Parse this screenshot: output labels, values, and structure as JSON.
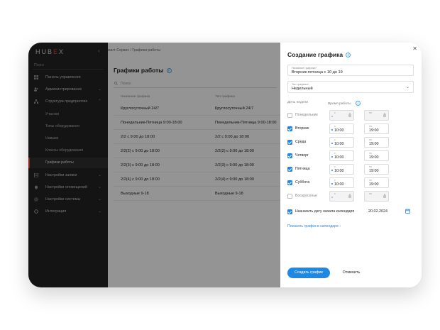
{
  "app": {
    "logo_prefix": "HUB",
    "logo_x": "E",
    "logo_suffix": "X"
  },
  "sidebar": {
    "search_placeholder": "Поиск",
    "items": [
      {
        "label": "Панель управления",
        "icon": "dashboard-icon"
      },
      {
        "label": "Администрирование",
        "icon": "users-icon"
      },
      {
        "label": "Структура предприятия",
        "icon": "structure-icon"
      },
      {
        "label": "Настройки заявки",
        "icon": "requests-icon"
      },
      {
        "label": "Настройки оповещений",
        "icon": "bell-icon"
      },
      {
        "label": "Настройки системы",
        "icon": "settings-icon"
      },
      {
        "label": "Интеграция",
        "icon": "integration-icon"
      }
    ],
    "subitems": [
      "Участки",
      "Типы оборудования",
      "Навыки",
      "Классы оборудования",
      "Графики работы"
    ]
  },
  "main": {
    "breadcrumb": "мarт-Сервис / Графики работы",
    "title": "Графики работы",
    "search_placeholder": "Поиск",
    "columns": [
      "Название графика",
      "Тип графика"
    ],
    "rows": [
      {
        "name": "Круглосуточный 24/7",
        "type": "Круглосуточный 24/7"
      },
      {
        "name": "Понедельник-Пятница 9:00-18:00",
        "type": "Понедельник-Пятница 9:00-18:00"
      },
      {
        "name": "2/2 с 9:00 до 18:00",
        "type": "2/2 с 9:00 до 18:00"
      },
      {
        "name": "2/2(2) с 9:00 до 18:00",
        "type": "2/2(2) с 9:00 до 18:00"
      },
      {
        "name": "2/2(3) с 9:00 до 18:00",
        "type": "2/2(3) с 9:00 до 18:00"
      },
      {
        "name": "2/2(4) с 9:00 до 18:00",
        "type": "2/2(4) с 9:00 до 18:00"
      },
      {
        "name": "Выходные 9-18",
        "type": "Выходные 9-18"
      }
    ]
  },
  "panel": {
    "title": "Создание графика",
    "name_label": "Название графика*",
    "name_value": "Вторник-пятница с 10 до 19",
    "type_label": "Тип графика*",
    "type_value": "Недельный",
    "col_day": "День недели",
    "col_time": "Время работы",
    "from_label": "с",
    "to_label": "по",
    "days": [
      {
        "name": "Понедельник",
        "checked": false,
        "from": "",
        "to": ""
      },
      {
        "name": "Вторник",
        "checked": true,
        "from": "10:00",
        "to": "19:00"
      },
      {
        "name": "Среда",
        "checked": true,
        "from": "10:00",
        "to": "19:00"
      },
      {
        "name": "Четверг",
        "checked": true,
        "from": "10:00",
        "to": "19:00"
      },
      {
        "name": "Пятница",
        "checked": true,
        "from": "10:00",
        "to": "19:00"
      },
      {
        "name": "Суббота",
        "checked": true,
        "from": "10:00",
        "to": "19:00"
      },
      {
        "name": "Воскресенье",
        "checked": false,
        "from": "",
        "to": ""
      }
    ],
    "calendar_label": "Назначить дату начала календаря",
    "calendar_date": "20.02.2024",
    "show_link": "Показать график в календаре",
    "create_btn": "Создать график",
    "cancel_btn": "Отменить"
  },
  "colors": {
    "accent": "#1e88e5",
    "brand_red": "#e53935",
    "sidebar_bg": "#232325"
  }
}
